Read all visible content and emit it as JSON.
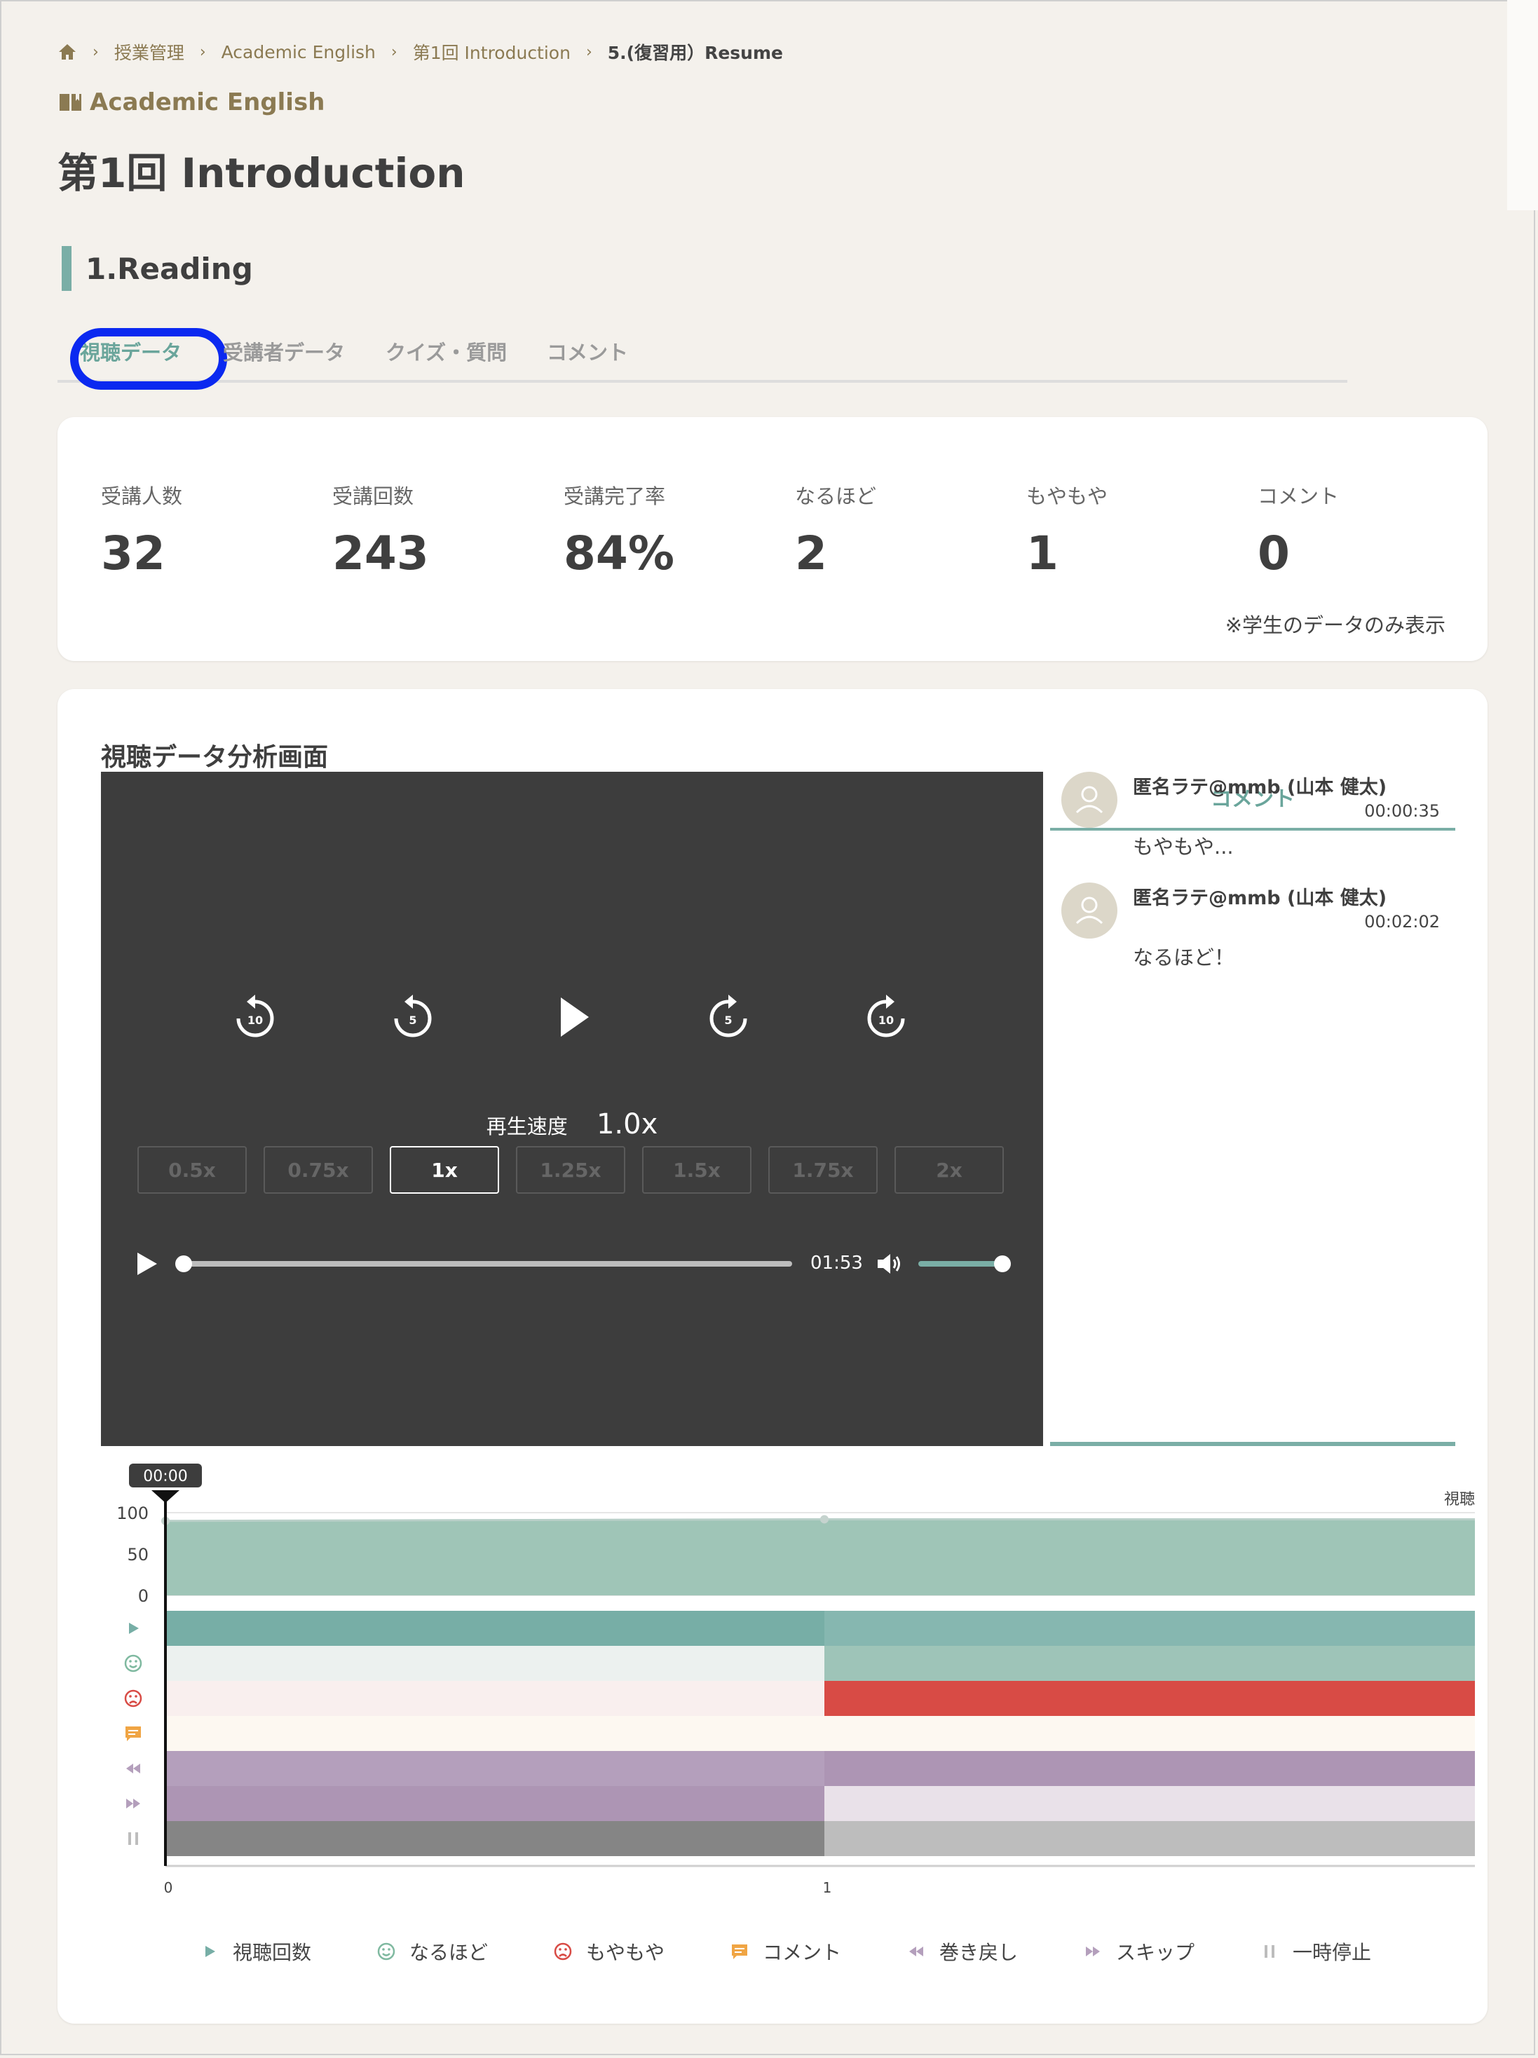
{
  "breadcrumb": {
    "items": [
      "授業管理",
      "Academic English",
      "第1回 Introduction"
    ],
    "current": "5.(復習用）Resume"
  },
  "course_name": "Academic English",
  "page_title": "第1回 Introduction",
  "section_title": "1.Reading",
  "tabs": [
    {
      "label": "視聴データ",
      "active": true
    },
    {
      "label": "受講者データ",
      "active": false
    },
    {
      "label": "クイズ・質問",
      "active": false
    },
    {
      "label": "コメント",
      "active": false
    }
  ],
  "stats": [
    {
      "label": "受講人数",
      "value": "32"
    },
    {
      "label": "受講回数",
      "value": "243"
    },
    {
      "label": "受講完了率",
      "value": "84%"
    },
    {
      "label": "なるほど",
      "value": "2"
    },
    {
      "label": "もやもや",
      "value": "1"
    },
    {
      "label": "コメント",
      "value": "0"
    }
  ],
  "stats_note": "※学生のデータのみ表示",
  "analysis": {
    "title": "視聴データ分析画面",
    "player": {
      "controls": [
        "rewind-10",
        "rewind-5",
        "play",
        "forward-5",
        "forward-10"
      ],
      "speed_label": "再生速度",
      "speed_value": "1.0x",
      "speed_options": [
        "0.5x",
        "0.75x",
        "1x",
        "1.25x",
        "1.5x",
        "1.75x",
        "2x"
      ],
      "selected_speed": "1x",
      "time": "01:53",
      "progress": 0,
      "volume": 1.0
    },
    "comments": {
      "header": "コメント",
      "items": [
        {
          "name": "匿名ラテ@mmb (山本 健太)",
          "time": "00:00:35",
          "text": "もやもや..."
        },
        {
          "name": "匿名ラテ@mmb (山本 健太)",
          "time": "00:02:02",
          "text": "なるほど！"
        }
      ]
    }
  },
  "chart_data": {
    "type": "area",
    "playhead_label": "00:00",
    "series_label": "視聴率",
    "y_ticks": [
      "100",
      "50",
      "0"
    ],
    "ylim": [
      0,
      100
    ],
    "x_ticks": [
      "0",
      "1"
    ],
    "x": [
      0,
      1,
      2
    ],
    "values": [
      90,
      92,
      92
    ],
    "heatmap_rows": [
      {
        "name": "視聴回数",
        "icon": "play-icon",
        "colors": [
          "#77aea6",
          "#86b7b0"
        ]
      },
      {
        "name": "なるほど",
        "icon": "smile-icon",
        "colors": [
          "#ecf1ef",
          "#9ec4b8"
        ]
      },
      {
        "name": "もやもや",
        "icon": "frown-icon",
        "colors": [
          "#f9efee",
          "#d84b45"
        ]
      },
      {
        "name": "コメント",
        "icon": "comment-icon",
        "colors": [
          "#fdf8f1",
          "#fdf8f1"
        ]
      },
      {
        "name": "巻き戻し",
        "icon": "rewind-icon",
        "colors": [
          "#b49fbc",
          "#ad95b4"
        ]
      },
      {
        "name": "スキップ",
        "icon": "skip-icon",
        "colors": [
          "#ad95b4",
          "#e9e1e9"
        ]
      },
      {
        "name": "一時停止",
        "icon": "pause-icon",
        "colors": [
          "#858585",
          "#bdbdbd"
        ]
      }
    ]
  },
  "legend": [
    {
      "label": "視聴回数",
      "icon": "play-icon",
      "color": "#77aea6"
    },
    {
      "label": "なるほど",
      "icon": "smile-icon",
      "color": "#7fb9a0"
    },
    {
      "label": "もやもや",
      "icon": "frown-icon",
      "color": "#d84b45"
    },
    {
      "label": "コメント",
      "icon": "comment-icon",
      "color": "#f0a544"
    },
    {
      "label": "巻き戻し",
      "icon": "rewind-icon",
      "color": "#b49fbc"
    },
    {
      "label": "スキップ",
      "icon": "skip-icon",
      "color": "#b49fbc"
    },
    {
      "label": "一時停止",
      "icon": "pause-icon",
      "color": "#bdbdbd"
    }
  ],
  "colors": {
    "accent": "#7aaea6",
    "brown": "#8b7a52",
    "tab_highlight": "#0b29f0",
    "player_bg": "#3d3d3d"
  }
}
